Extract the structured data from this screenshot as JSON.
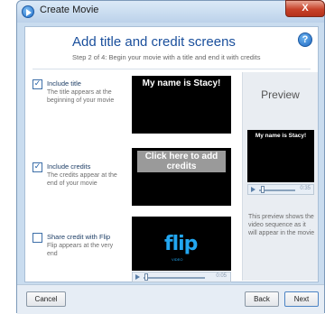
{
  "window": {
    "title": "Create Movie",
    "close_label": "X"
  },
  "header": {
    "title": "Add title and credit screens",
    "subtitle": "Step 2 of 4: Begin your movie with a title and end it with credits",
    "help_label": "?"
  },
  "options": [
    {
      "label": "Include title",
      "description": "The title appears at the beginning of your movie",
      "checked": true,
      "thumb_text": "My name is Stacy!"
    },
    {
      "label": "Include credits",
      "description": "The credits appear at the end of your movie",
      "checked": true,
      "thumb_text": "Click here to add credits"
    },
    {
      "label": "Share credit with Flip",
      "description": "Flip appears at the very end",
      "checked": false,
      "logo_text": "flip",
      "logo_sub": "VIDEO",
      "time": "0:05",
      "progress": 0.05
    }
  ],
  "preview": {
    "title": "Preview",
    "screen_text": "My name is Stacy!",
    "time": "0:35",
    "progress": 0.1,
    "description": "This preview shows the video sequence as it will appear in the movie"
  },
  "buttons": {
    "cancel": "Cancel",
    "back": "Back",
    "next": "Next"
  },
  "colors": {
    "accent": "#1a4f9c",
    "flip_blue": "#22a6f0"
  }
}
